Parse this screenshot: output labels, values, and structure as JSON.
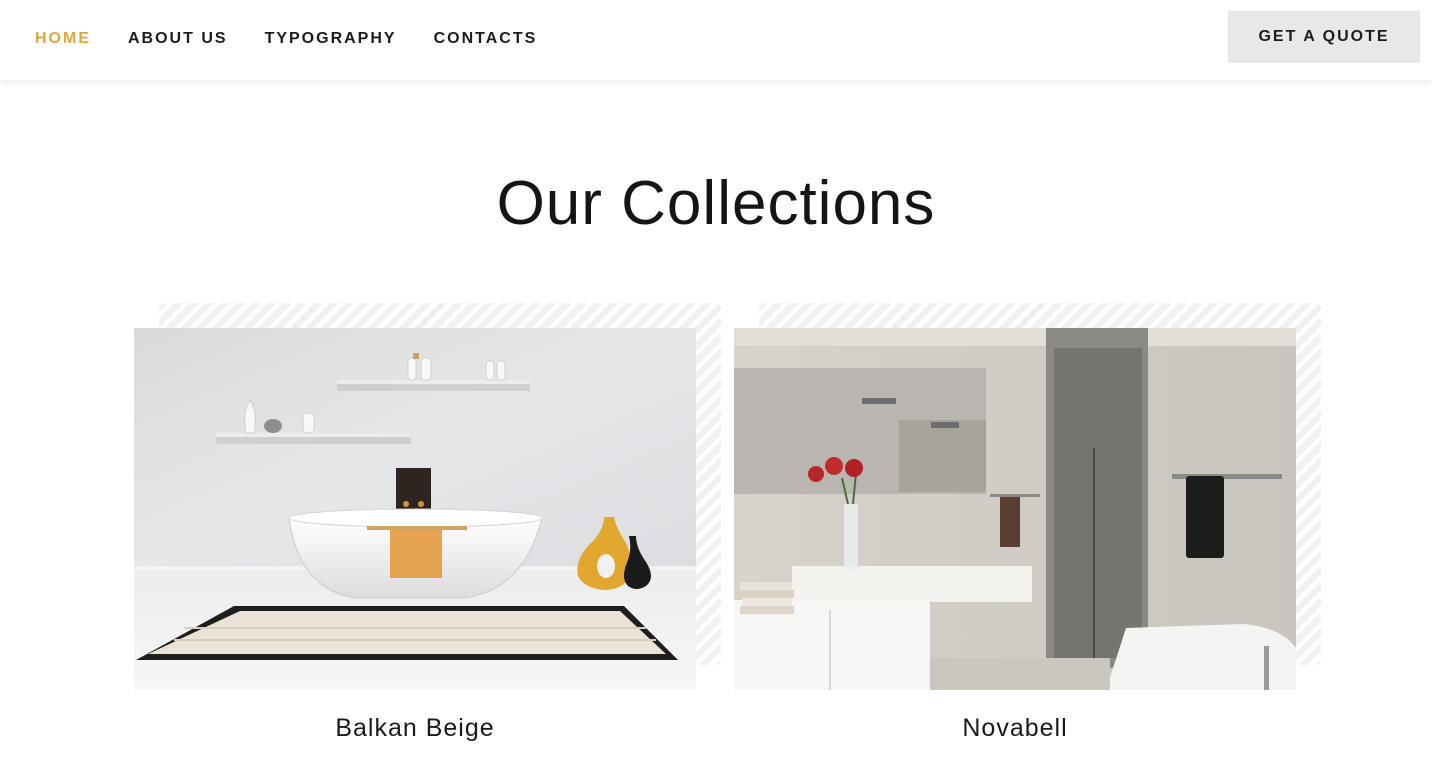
{
  "nav": {
    "items": [
      {
        "label": "HOME",
        "active": true
      },
      {
        "label": "ABOUT US",
        "active": false
      },
      {
        "label": "TYPOGRAPHY",
        "active": false
      },
      {
        "label": "CONTACTS",
        "active": false
      }
    ],
    "cta_label": "GET A QUOTE"
  },
  "colors": {
    "accent": "#e0a83a",
    "text": "#151515",
    "button_bg": "#e8e8e8"
  },
  "main": {
    "title": "Our Collections",
    "collections": [
      {
        "name": "Balkan Beige",
        "image": "bathroom-freestanding-tub-image"
      },
      {
        "name": "Novabell",
        "image": "bathroom-vanity-shower-image"
      }
    ]
  }
}
